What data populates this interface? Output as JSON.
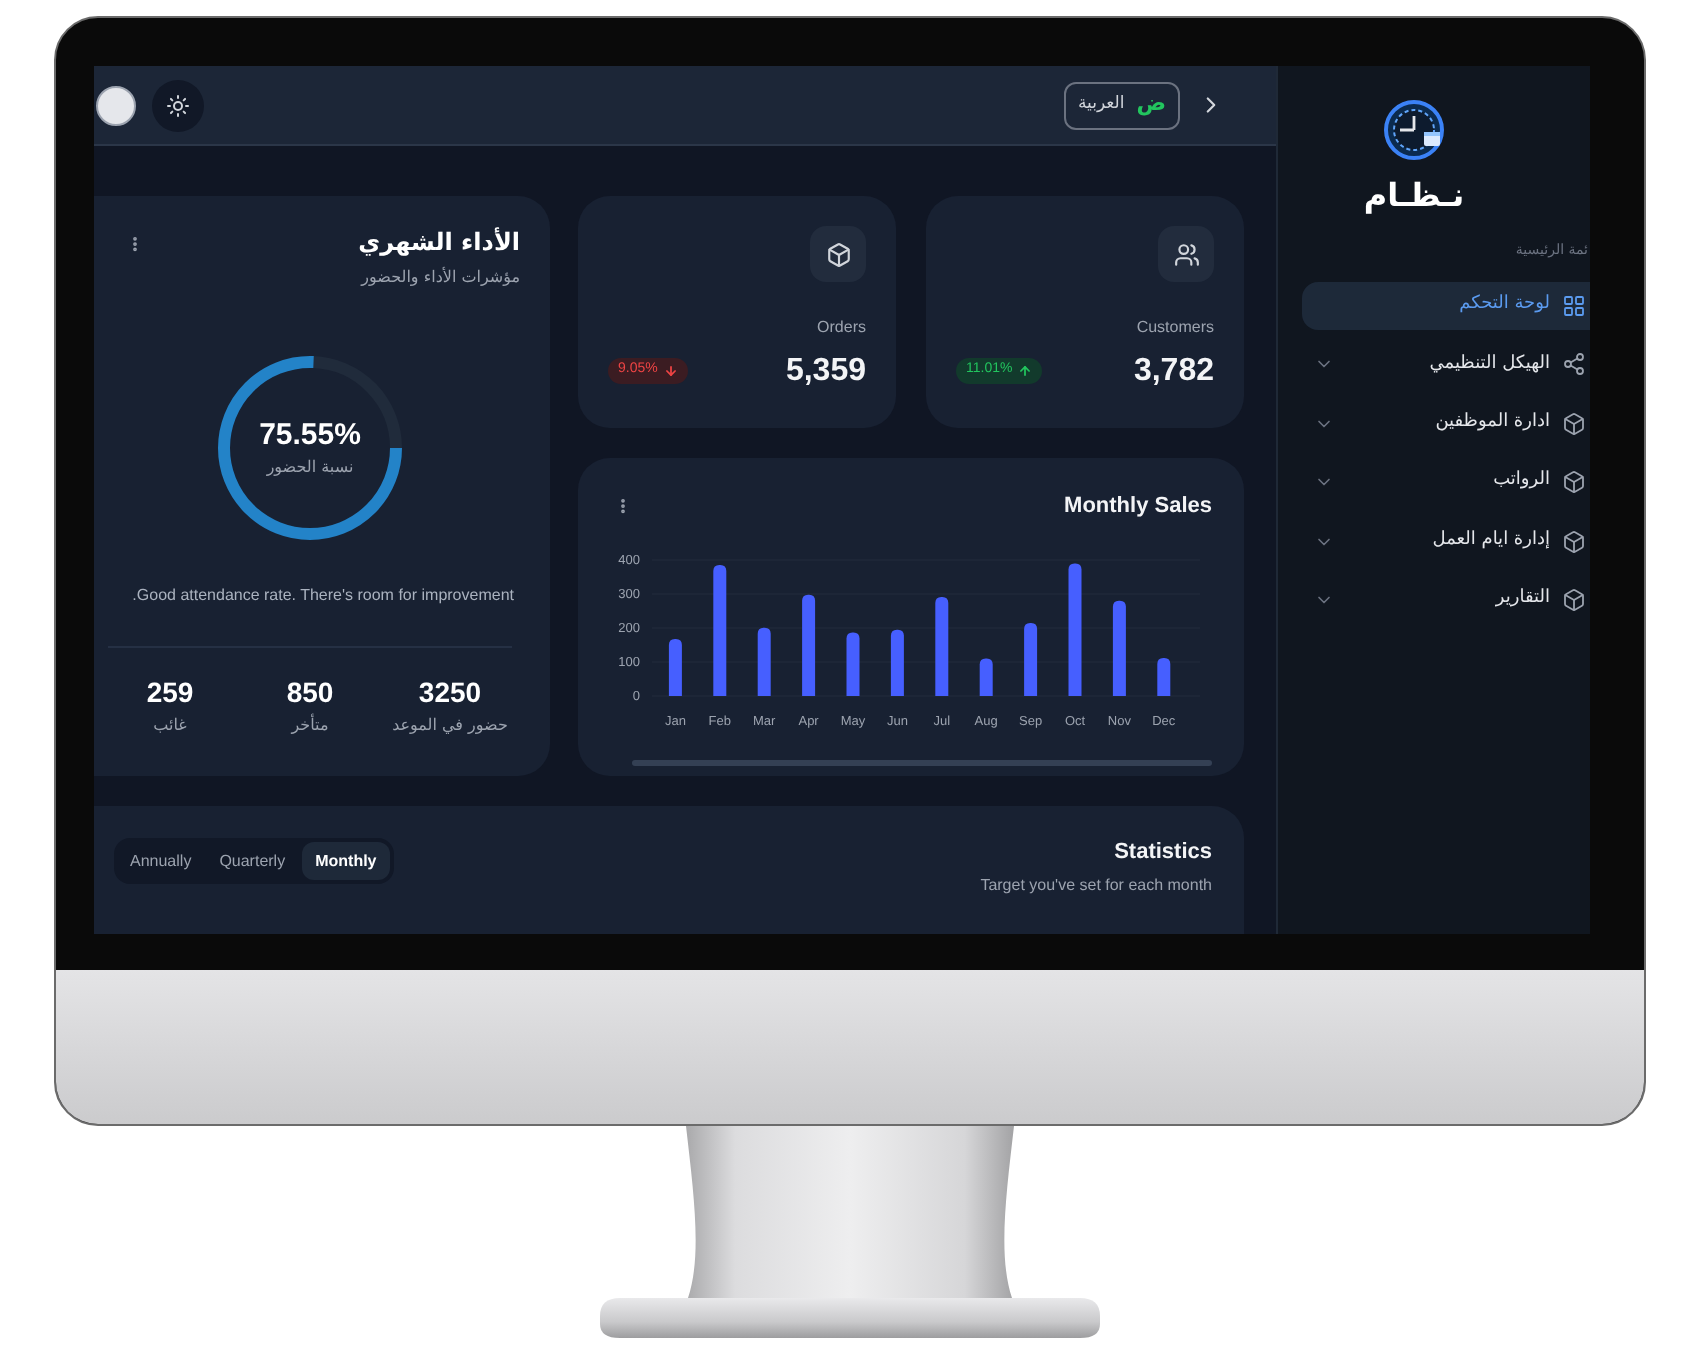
{
  "header": {
    "language_button": {
      "letter": "ض",
      "label": "العربية"
    }
  },
  "sidebar": {
    "logo_text": "نـظـام",
    "section_label": "ئمة الرئيسية",
    "items": [
      {
        "label": "لوحة التحكم",
        "selected": true
      },
      {
        "label": "الهيكل التنظيمي",
        "selected": false,
        "expanded": false
      },
      {
        "label": "ادارة الموظفين",
        "selected": false,
        "expanded": false
      },
      {
        "label": "الرواتب",
        "selected": false,
        "expanded": false
      },
      {
        "label": "إدارة ايام العمل",
        "selected": false,
        "expanded": false
      },
      {
        "label": "التقارير",
        "selected": false,
        "expanded": false
      }
    ]
  },
  "stat_cards": [
    {
      "label": "Customers",
      "value": "3,782",
      "change": "11.01%",
      "kind": "increase"
    },
    {
      "label": "Orders",
      "value": "5,359",
      "change": "9.05%",
      "kind": "decrease"
    }
  ],
  "performance": {
    "title": "الأداء الشهري",
    "subtitle": "مؤشرات الأداء والحضور",
    "attendance": {
      "level": 0.7555,
      "percent": "75.55%",
      "label": "نسبة الحضور"
    },
    "note": "Good attendance rate. There's room for improvement.",
    "stats": [
      {
        "value": "3250",
        "label": "حضور في الموعد"
      },
      {
        "value": "850",
        "label": "متأخر"
      },
      {
        "value": "259",
        "label": "غائب"
      }
    ]
  },
  "monthly_sales": {
    "chart_data": {
      "type": "bar",
      "title": "Monthly Sales",
      "categories": [
        "Jan",
        "Feb",
        "Mar",
        "Apr",
        "May",
        "Jun",
        "Jul",
        "Aug",
        "Sep",
        "Oct",
        "Nov",
        "Dec"
      ],
      "series": [
        {
          "color": "#465fff",
          "values": [
            168,
            385,
            201,
            298,
            187,
            195,
            291,
            110,
            215,
            390,
            280,
            112
          ]
        }
      ],
      "ylim": [
        0,
        400
      ],
      "yticks": [
        0,
        100,
        200,
        300,
        400
      ]
    }
  },
  "statistics": {
    "title": "Statistics",
    "subtitle": "Target you've set for each month",
    "tabs": [
      {
        "label": "Monthly",
        "selected": true
      },
      {
        "label": "Quarterly",
        "selected": false
      },
      {
        "label": "Annually",
        "selected": false
      }
    ]
  }
}
